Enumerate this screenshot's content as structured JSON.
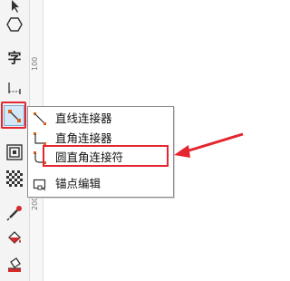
{
  "toolbox": {
    "text_tool_glyph": "字",
    "tools": [
      {
        "name": "pick-tool-icon"
      },
      {
        "name": "polygon-tool-icon"
      },
      {
        "name": "text-tool-icon"
      },
      {
        "name": "dimension-tool-icon"
      },
      {
        "name": "connector-tool-icon"
      },
      {
        "name": "blend-tool-icon"
      },
      {
        "name": "transparency-tool-icon"
      },
      {
        "name": "eyedropper-tool-icon"
      },
      {
        "name": "fill-tool-icon"
      },
      {
        "name": "smart-fill-tool-icon"
      }
    ]
  },
  "ruler": {
    "mark_1": "100",
    "mark_2": "200"
  },
  "flyout": {
    "items": [
      {
        "label": "直线连接器",
        "icon": "straight-connector-icon"
      },
      {
        "label": "直角连接器",
        "icon": "right-angle-connector-icon"
      },
      {
        "label": "圆直角连接符",
        "icon": "rounded-right-angle-connector-icon"
      },
      {
        "label": "锚点编辑",
        "icon": "anchor-edit-icon"
      }
    ]
  },
  "colors": {
    "highlight": "#e3262f",
    "selection": "#d5e8f7"
  }
}
